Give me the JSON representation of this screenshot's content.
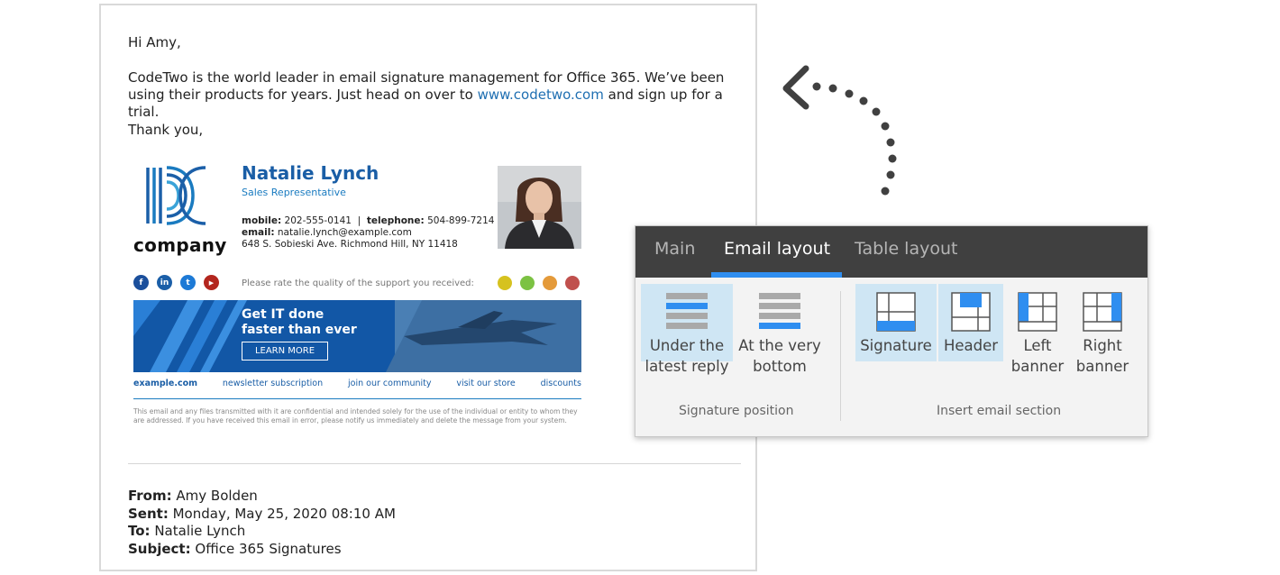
{
  "email": {
    "greeting": "Hi Amy,",
    "paragraph_before_link": "CodeTwo is the world leader in email signature management for Office 365. We’ve been using their products for years. Just head on over to ",
    "link_text": "www.codetwo.com",
    "paragraph_after_link": " and sign up for a trial.",
    "closing": "Thank you,",
    "signature": {
      "logo_word": "company",
      "name": "Natalie Lynch",
      "title": "Sales Representative",
      "mobile_label": "mobile:",
      "mobile": "202-555-0141",
      "divider": "|",
      "telephone_label": "telephone:",
      "telephone": "504-899-7214",
      "email_label": "email:",
      "email": "natalie.lynch@example.com",
      "address": "648 S. Sobieski Ave. Richmond Hill, NY 11418",
      "social": [
        {
          "icon": "facebook-icon",
          "glyph": "f",
          "color": "#1b4f9c"
        },
        {
          "icon": "linkedin-icon",
          "glyph": "in",
          "color": "#1b5fa8"
        },
        {
          "icon": "twitter-icon",
          "glyph": "t",
          "color": "#1d7ad6"
        },
        {
          "icon": "youtube-icon",
          "glyph": "▶",
          "color": "#b3261e"
        }
      ],
      "rate_text": "Please rate the quality of the support you received:",
      "smileys": [
        {
          "icon": "very-happy-smiley-icon",
          "color": "#d6c21f"
        },
        {
          "icon": "happy-smiley-icon",
          "color": "#7cc243"
        },
        {
          "icon": "neutral-smiley-icon",
          "color": "#e49a3a"
        },
        {
          "icon": "sad-smiley-icon",
          "color": "#c0504d"
        }
      ],
      "banner": {
        "line1": "Get IT done",
        "line2": "faster than ever",
        "button": "LEARN MORE"
      },
      "links": [
        "example.com",
        "newsletter subscription",
        "join our community",
        "visit our store",
        "discounts"
      ],
      "disclaimer": "This email and any files transmitted with it are confidential and intended solely for the use of the individual or entity to whom they are addressed. If you have received this email in error, please notify us immediately and delete the message from your system."
    },
    "meta": {
      "from_label": "From:",
      "from": "Amy Bolden",
      "sent_label": "Sent:",
      "sent": "Monday, May 25, 2020 08:10 AM",
      "to_label": "To:",
      "to": "Natalie Lynch",
      "subject_label": "Subject:",
      "subject": "Office 365 Signatures"
    }
  },
  "ribbon": {
    "tabs": [
      "Main",
      "Email layout",
      "Table layout"
    ],
    "active_tab": "Email layout",
    "accent": "#2f8ef0",
    "signature_position": {
      "group_label": "Signature position",
      "buttons": [
        {
          "line1": "Under the",
          "line2": "latest reply",
          "selected": true
        },
        {
          "line1": "At the very",
          "line2": "bottom",
          "selected": false
        }
      ]
    },
    "insert_section": {
      "group_label": "Insert email section",
      "buttons": [
        {
          "line1": "Signature",
          "line2": "",
          "selected": true
        },
        {
          "line1": "Header",
          "line2": "",
          "selected": true
        },
        {
          "line1": "Left",
          "line2": "banner",
          "selected": false
        },
        {
          "line1": "Right",
          "line2": "banner",
          "selected": false
        }
      ]
    }
  }
}
